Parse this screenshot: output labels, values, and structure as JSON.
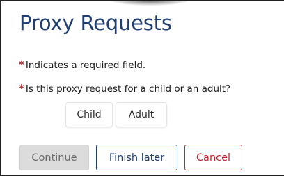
{
  "page": {
    "title": "Proxy Requests"
  },
  "required_note": {
    "marker": "*",
    "text": "Indicates a required field."
  },
  "question": {
    "marker": "*",
    "text": "Is this proxy request for a child or an adult?",
    "options": [
      "Child",
      "Adult"
    ]
  },
  "actions": {
    "continue_label": "Continue",
    "finish_later_label": "Finish later",
    "cancel_label": "Cancel"
  },
  "colors": {
    "title": "#1f3f73",
    "required_marker": "#c0262d",
    "primary_outline": "#1f3f73",
    "danger_outline": "#c0262d",
    "disabled_bg": "#dcdcdc"
  }
}
